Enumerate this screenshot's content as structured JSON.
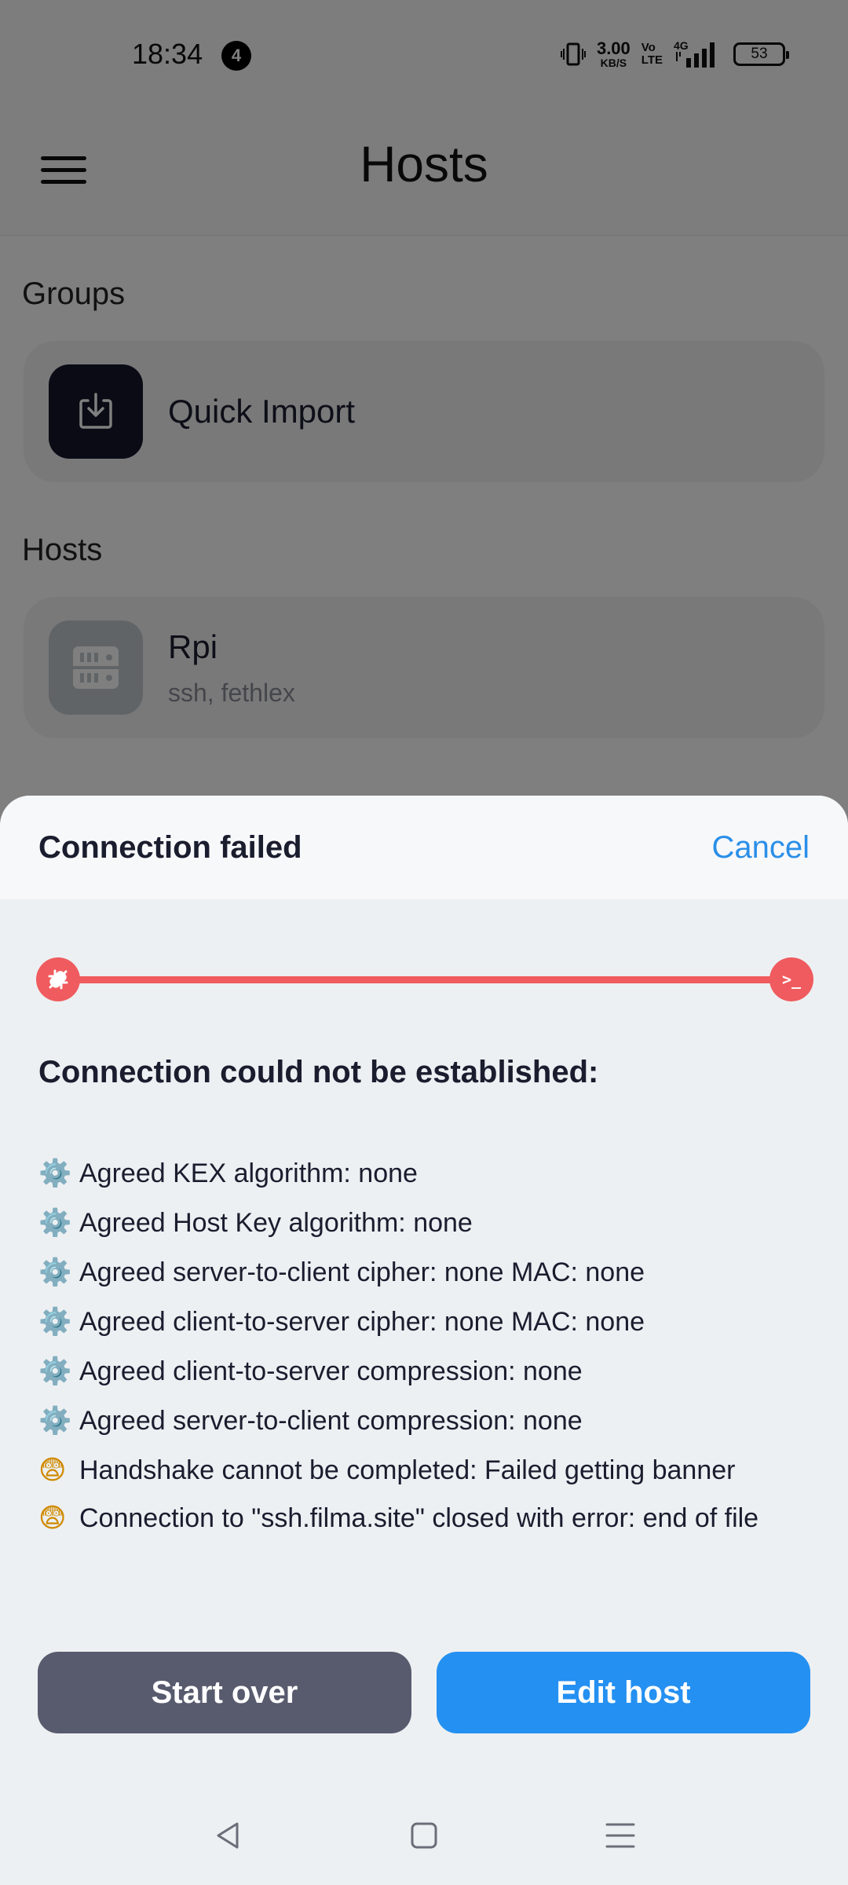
{
  "status_bar": {
    "time": "18:34",
    "notification_count": "4",
    "net_speed_value": "3.00",
    "net_speed_unit": "KB/S",
    "volte_top": "Vo",
    "volte_bottom": "LTE",
    "network_type": "4G",
    "battery": "53"
  },
  "app_bar": {
    "title": "Hosts",
    "menu_icon": "hamburger-menu-icon"
  },
  "groups": {
    "label": "Groups",
    "items": [
      {
        "title": "Quick Import",
        "icon": "import-icon",
        "icon_bg": "#14172a"
      }
    ]
  },
  "hosts": {
    "label": "Hosts",
    "items": [
      {
        "title": "Rpi",
        "subtitle": "ssh, fethlex",
        "icon": "server-icon",
        "icon_bg": "#c3c8cc"
      }
    ]
  },
  "sheet": {
    "title": "Connection failed",
    "cancel_label": "Cancel",
    "progress": {
      "status": "failed",
      "color": "#ef5b5e",
      "start_icon": "disconnected-plug-icon",
      "end_icon": "terminal-icon",
      "end_label": ">_"
    },
    "error_heading": "Connection could not be established:",
    "log": [
      {
        "emoji": "⚙️",
        "text": "Agreed KEX algorithm: none"
      },
      {
        "emoji": "⚙️",
        "text": "Agreed Host Key algorithm: none"
      },
      {
        "emoji": "⚙️",
        "text": "Agreed server-to-client cipher: none MAC: none"
      },
      {
        "emoji": "⚙️",
        "text": "Agreed client-to-server cipher: none MAC: none"
      },
      {
        "emoji": "⚙️",
        "text": "Agreed client-to-server compression: none"
      },
      {
        "emoji": "⚙️",
        "text": "Agreed server-to-client compression: none"
      },
      {
        "emoji": "😨",
        "text": "Handshake cannot be completed: Failed getting banner"
      },
      {
        "emoji": "😨",
        "text": "Connection to \"ssh.filma.site\" closed with error: end of file"
      }
    ],
    "buttons": {
      "start_over": "Start over",
      "edit_host": "Edit host"
    }
  },
  "nav_bar": {
    "back_icon": "back-triangle-icon",
    "home_icon": "home-square-icon",
    "recents_icon": "recents-lines-icon"
  },
  "colors": {
    "accent": "#2490f1",
    "error": "#ef5b5e",
    "secondary_button": "#585b6e",
    "sheet_background": "#edf0f2"
  }
}
